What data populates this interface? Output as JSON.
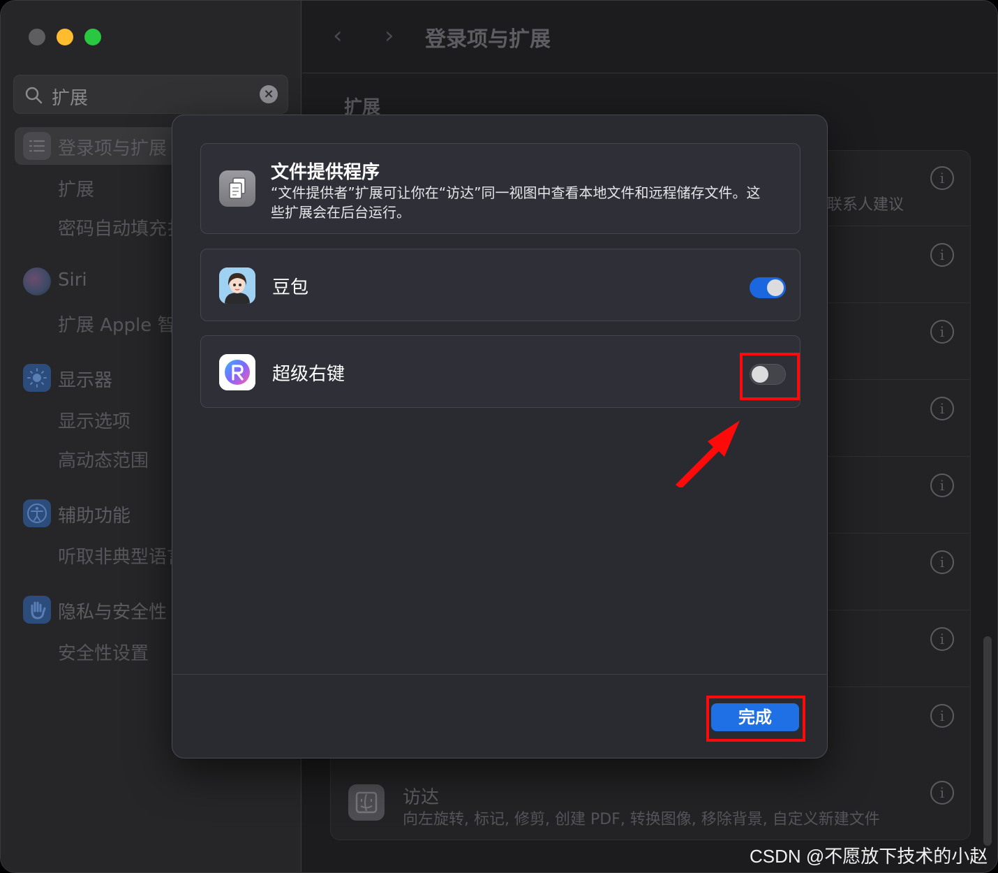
{
  "window": {
    "traffic_lights": {
      "close": "#5e5e61",
      "minimize": "#febc2e",
      "maximize": "#28c840"
    }
  },
  "sidebar": {
    "search": {
      "value": "扩展",
      "icon": "magnifier-icon",
      "clear_icon": "close-circle-icon"
    },
    "items": [
      {
        "label": "登录项与扩展",
        "icon": "list-icon",
        "selected": true,
        "subitems": [
          "扩展",
          "密码自动填充扌"
        ]
      },
      {
        "label": "Siri",
        "icon": "siri-orb-icon",
        "subitems": [
          "扩展 Apple 智能"
        ]
      },
      {
        "label": "显示器",
        "icon": "sun-icon",
        "subitems": [
          "显示选项",
          "高动态范围"
        ]
      },
      {
        "label": "辅助功能",
        "icon": "accessibility-icon",
        "subitems": [
          "听取非典型语言"
        ]
      },
      {
        "label": "隐私与安全性",
        "icon": "hand-icon",
        "subitems": [
          "安全性设置"
        ]
      }
    ]
  },
  "main": {
    "toolbar": {
      "back": "‹",
      "forward": "›",
      "title": "登录项与扩展"
    },
    "section_title": "扩展",
    "contact_hint": "联系人建议",
    "finder_row": {
      "title": "访达",
      "description": "向左旋转, 标记, 修剪, 创建 PDF, 转换图像, 移除背景, 自定义新建文件"
    }
  },
  "modal": {
    "provider": {
      "title": "文件提供程序",
      "description": "“文件提供者”扩展可让你在“访达”同一视图中查看本地文件和远程储存文件。这些扩展会在后台运行。",
      "icon": "documents-icon"
    },
    "apps": [
      {
        "name": "豆包",
        "enabled": true,
        "icon": "doubao-avatar-icon"
      },
      {
        "name": "超级右键",
        "enabled": false,
        "icon": "super-right-click-icon"
      }
    ],
    "done_label": "完成"
  },
  "annotations": {
    "highlight_color": "#ff0a0a"
  },
  "watermark": "CSDN @不愿放下技术的小赵",
  "colors": {
    "accent": "#1f6fe5",
    "toggle_on": "#1b67e0"
  }
}
